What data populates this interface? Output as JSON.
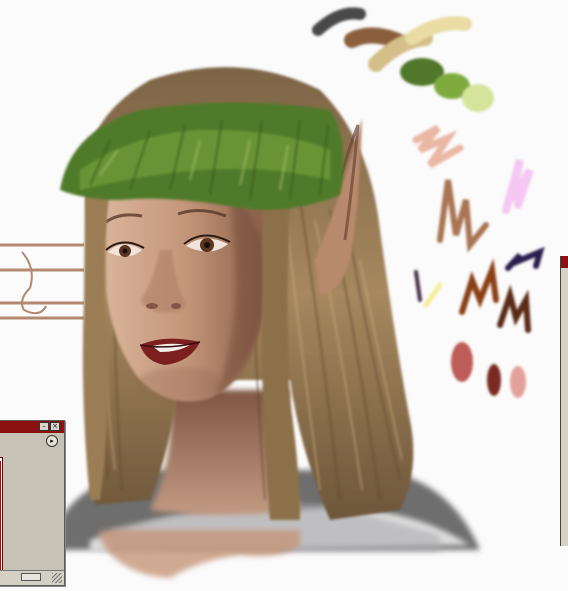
{
  "artwork": {
    "subject": "elf-portrait-painting",
    "colors": {
      "skin": "#c59b7f",
      "skin_shadow": "#8e6650",
      "hair": "#9e7f57",
      "hair_dark": "#5e4a33",
      "wreath": "#4f7a29",
      "lips": "#7b1f1f",
      "background": "#fbfbfb"
    },
    "color_swatches": [
      {
        "name": "charcoal",
        "color": "#4a4a4a"
      },
      {
        "name": "brown",
        "color": "#8a5f3e"
      },
      {
        "name": "tan",
        "color": "#d5bf88"
      },
      {
        "name": "pale-yellow",
        "color": "#e9dca4"
      },
      {
        "name": "dark-green",
        "color": "#51772a"
      },
      {
        "name": "mid-green",
        "color": "#7faa3c"
      },
      {
        "name": "light-green",
        "color": "#d6e39a"
      },
      {
        "name": "peach",
        "color": "#e9b7a4"
      },
      {
        "name": "pink",
        "color": "#f4c8f2"
      },
      {
        "name": "skin-brown",
        "color": "#a97552"
      },
      {
        "name": "navy",
        "color": "#2a1b4d"
      },
      {
        "name": "yellow",
        "color": "#f5ee9a"
      },
      {
        "name": "rust",
        "color": "#8a3f18"
      },
      {
        "name": "dark-brown",
        "color": "#5a2a12"
      },
      {
        "name": "red",
        "color": "#b74b47"
      },
      {
        "name": "maroon",
        "color": "#7a2c21"
      },
      {
        "name": "salmon",
        "color": "#e0928a"
      }
    ]
  },
  "palette_window": {
    "title_color": "#8d1010",
    "minimize_icon": "minimize-icon",
    "close_icon": "close-icon",
    "menu_icon": "triangle-right-icon"
  }
}
